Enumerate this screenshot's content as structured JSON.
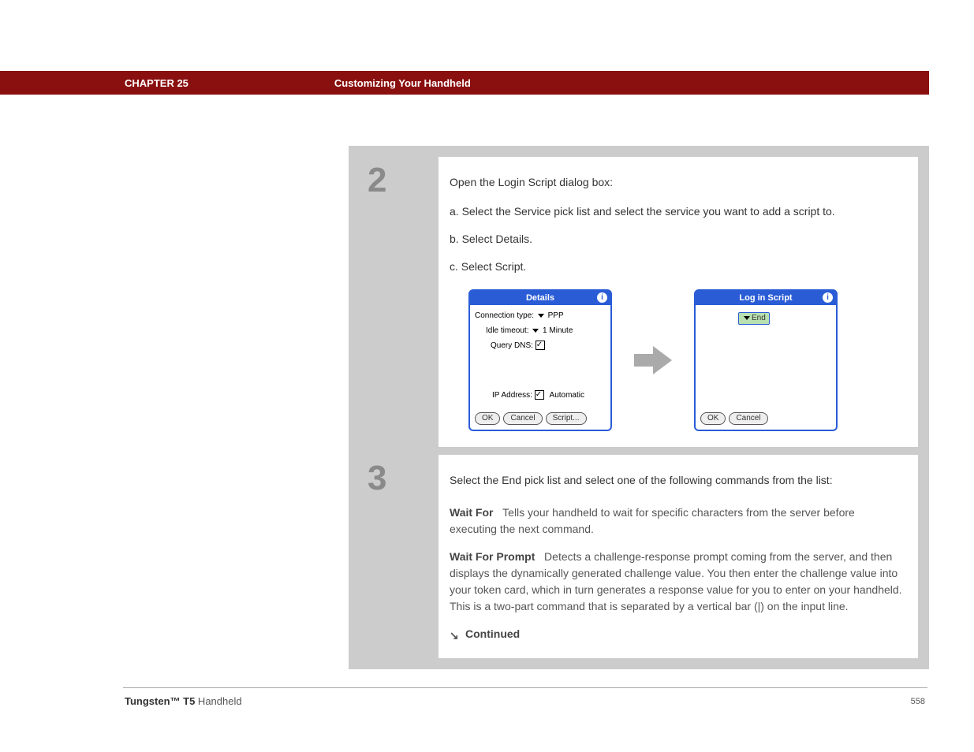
{
  "header": {
    "chapter": "CHAPTER 25",
    "section": "Customizing Your Handheld"
  },
  "step2": {
    "number": "2",
    "lead": "Open the Login Script dialog box:",
    "a": "a.  Select the Service pick list and select the service you want to add a script to.",
    "b": "b.  Select Details.",
    "c": "c.  Select Script.",
    "details_window": {
      "title": "Details",
      "conn_label": "Connection type:",
      "conn_value": "PPP",
      "idle_label": "Idle timeout:",
      "idle_value": "1 Minute",
      "dns_label": "Query DNS:",
      "ip_label": "IP Address:",
      "ip_value": "Automatic",
      "ok": "OK",
      "cancel": "Cancel",
      "script": "Script..."
    },
    "script_window": {
      "title": "Log in Script",
      "pick_value": "End",
      "ok": "OK",
      "cancel": "Cancel"
    }
  },
  "step3": {
    "number": "3",
    "lead": "Select the End pick list and select one of the following commands from the list:",
    "waitfor_name": "Wait For",
    "waitfor_text": "Tells your handheld to wait for specific characters from the server before executing the next command.",
    "waitforprompt_name": "Wait For Prompt",
    "waitforprompt_text": "Detects a challenge-response prompt coming from the server, and then displays the dynamically generated challenge value. You then enter the challenge value into your token card, which in turn generates a response value for you to enter on your handheld. This is a two-part command that is separated by a vertical bar (|) on the input line.",
    "continued": "Continued"
  },
  "footer": {
    "product_bold": "Tungsten™ T5",
    "product_rest": " Handheld",
    "page": "558"
  }
}
